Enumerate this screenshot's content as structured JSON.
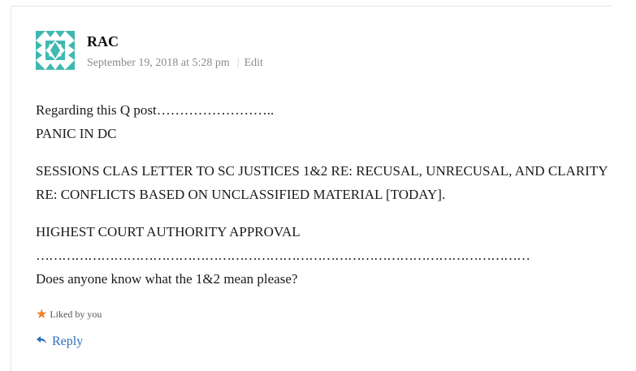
{
  "comment": {
    "author": "RAC",
    "date": "September 19, 2018 at 5:28 pm",
    "separator": "|",
    "edit_label": "Edit",
    "paragraphs": [
      "Regarding this Q post……………………..",
      "PANIC IN DC",
      "SESSIONS CLAS LETTER TO SC JUSTICES 1&2 RE: RECUSAL, UNRECUSAL, AND CLARITY",
      "RE: CONFLICTS BASED ON UNCLASSIFIED MATERIAL [TODAY].",
      "HIGHEST COURT AUTHORITY APPROVAL",
      "……………………………………………………………………………………………………",
      "Does anyone know what the 1&2 mean please?"
    ],
    "liked_text": "Liked by you",
    "reply_label": "Reply"
  },
  "colors": {
    "avatar": "#3fb8b0",
    "accent": "#2a6ebb",
    "star": "#f0821e"
  },
  "icons": {
    "avatar": "identicon-avatar",
    "like": "star-icon",
    "reply": "reply-arrow-icon"
  }
}
